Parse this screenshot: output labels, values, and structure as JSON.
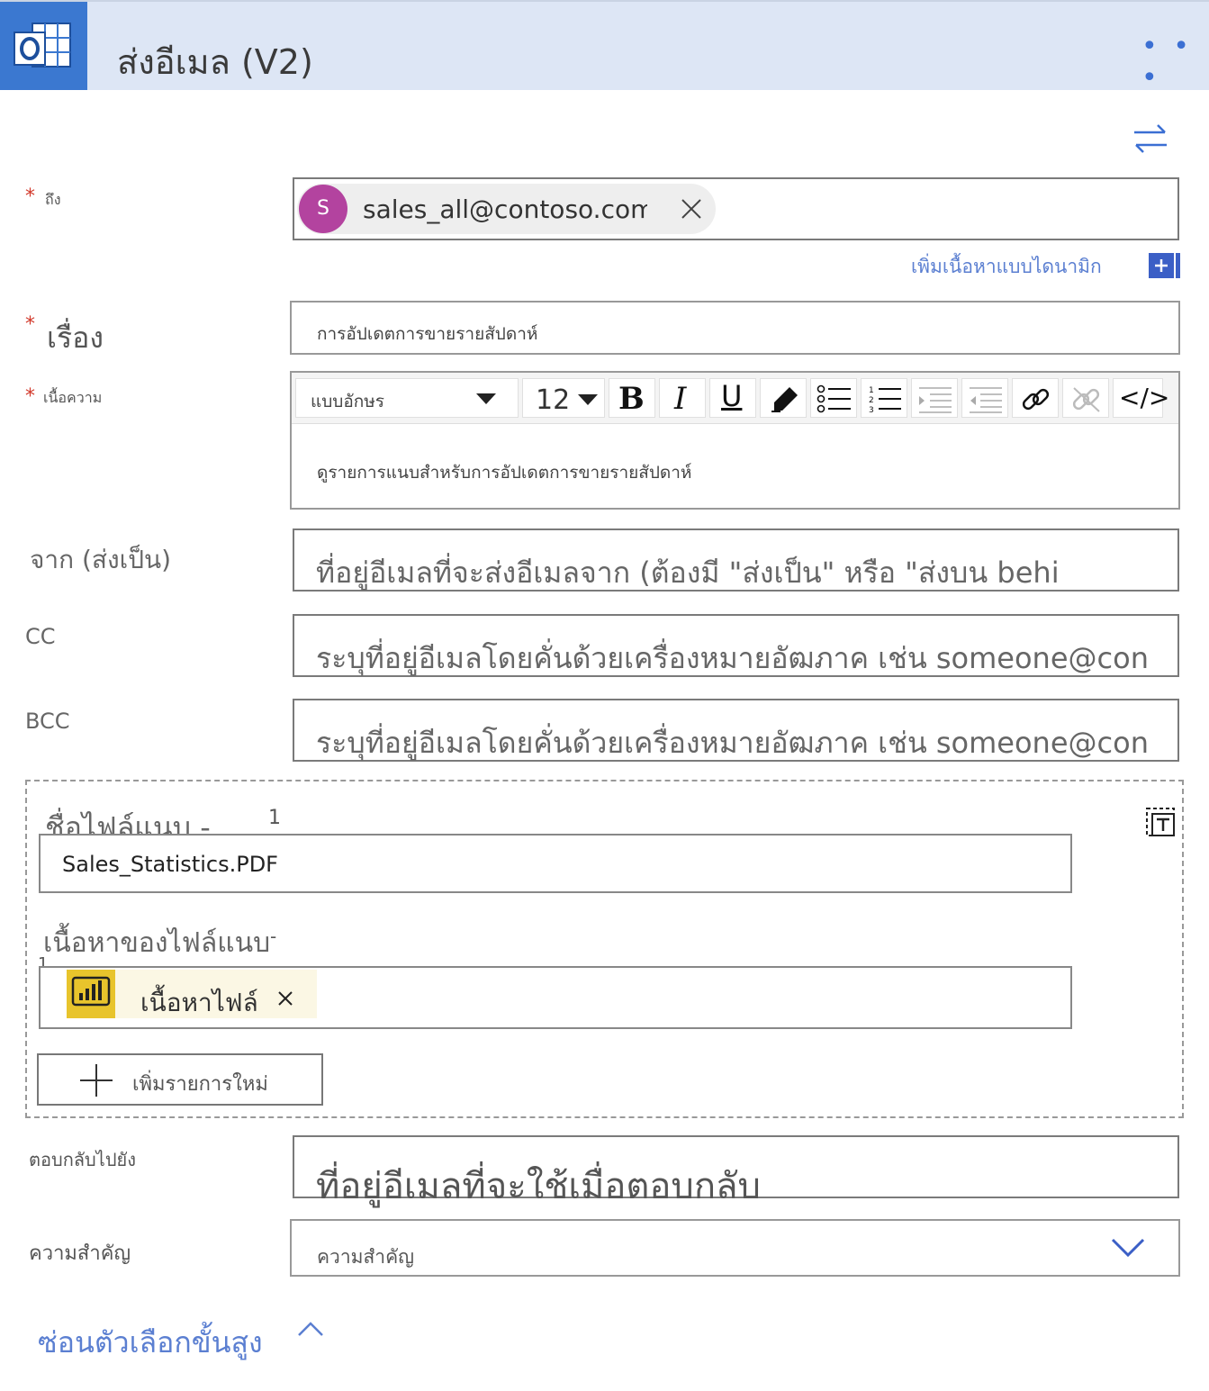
{
  "header": {
    "title": "ส่งอีเมล (V2)",
    "more": "• • •"
  },
  "to": {
    "label": "ถึง",
    "chip_initial": "S",
    "chip_text": "sales_all@contoso.com",
    "add_dynamic": "เพิ่มเนื้อหาแบบไดนามิก"
  },
  "subject": {
    "label": "เรื่อง",
    "value": "การอัปเดตการขายรายสัปดาห์"
  },
  "body": {
    "label": "เนื้อความ",
    "font_select": "แบบอักษร",
    "font_size": "12",
    "text": "ดูรายการแนบสำหรับการอัปเดตการขายรายสัปดาห์"
  },
  "from": {
    "label": "จาก (ส่งเป็น)",
    "placeholder": "ที่อยู่อีเมลที่จะส่งอีเมลจาก (ต้องมี \"ส่งเป็น\" หรือ \"ส่งบน behi"
  },
  "cc": {
    "label": "CC",
    "placeholder": "ระบุที่อยู่อีเมลโดยคั่นด้วยเครื่องหมายอัฒภาค เช่น someone@con"
  },
  "bcc": {
    "label": "BCC",
    "placeholder": "ระบุที่อยู่อีเมลโดยคั่นด้วยเครื่องหมายอัฒภาค เช่น someone@con"
  },
  "attachments": {
    "name_label": "ชื่อไฟล์แนบ -",
    "name_index": "1",
    "name_value": "Sales_Statistics.PDF",
    "content_label": "เนื้อหาของไฟล์แนบ",
    "content_dash": "-",
    "content_index": "1",
    "content_token": "เนื้อหาไฟล์",
    "add_item": "เพิ่มรายการใหม่"
  },
  "reply_to": {
    "label": "ตอบกลับไปยัง",
    "placeholder": "ที่อยู่อีเมลที่จะใช้เมื่อตอบกลับ"
  },
  "importance": {
    "label": "ความสำคัญ",
    "value": "ความสำคัญ"
  },
  "advanced": {
    "toggle": "ซ่อนตัวเลือกขั้นสูง"
  },
  "colors": {
    "accent": "#3b6fd3",
    "header_bg": "#dde6f5",
    "required": "#d23a2c",
    "avatar": "#b3439f",
    "powerbi": "#e8c42c"
  }
}
